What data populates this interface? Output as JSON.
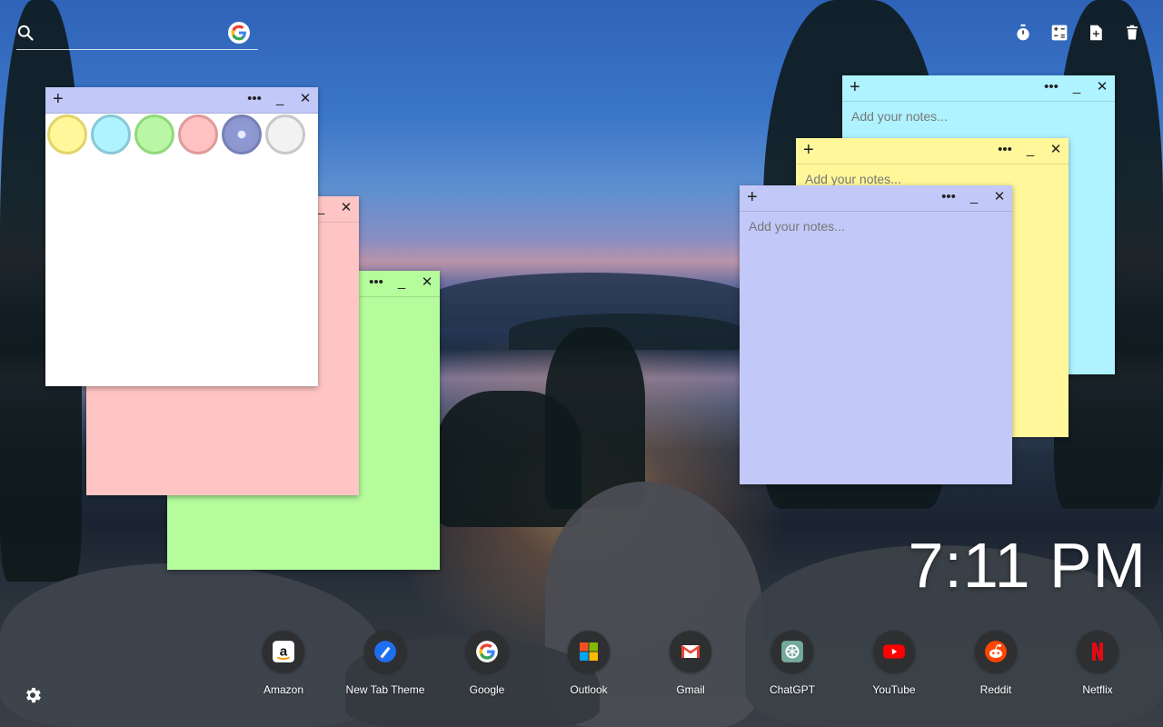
{
  "search": {
    "placeholder": ""
  },
  "toolbar": {
    "icons": [
      "timer-icon",
      "calculator-icon",
      "add-note-icon",
      "trash-icon"
    ]
  },
  "notes": {
    "palette": {
      "selected": "purple",
      "colors": [
        "#fff799",
        "#aef3ff",
        "#b9f6a6",
        "#ffc2c2",
        "#c5cbf6",
        "#f2f2f2"
      ]
    },
    "placeholder": "Add your notes...",
    "more_label": "•••",
    "minimize_label": "_",
    "close_label": "✕",
    "add_label": "+"
  },
  "clock": {
    "time": "7:11 PM"
  },
  "dock": [
    {
      "label": "Amazon"
    },
    {
      "label": "New Tab Theme"
    },
    {
      "label": "Google"
    },
    {
      "label": "Outlook"
    },
    {
      "label": "Gmail"
    },
    {
      "label": "ChatGPT"
    },
    {
      "label": "YouTube"
    },
    {
      "label": "Reddit"
    },
    {
      "label": "Netflix"
    }
  ],
  "colors": {
    "note_yellow": "#fff799",
    "note_cyan": "#aef3ff",
    "note_green": "#b5fc9c",
    "note_pink": "#ffc5c5",
    "note_purple": "#c2c8f7",
    "note_white": "#ffffff"
  }
}
